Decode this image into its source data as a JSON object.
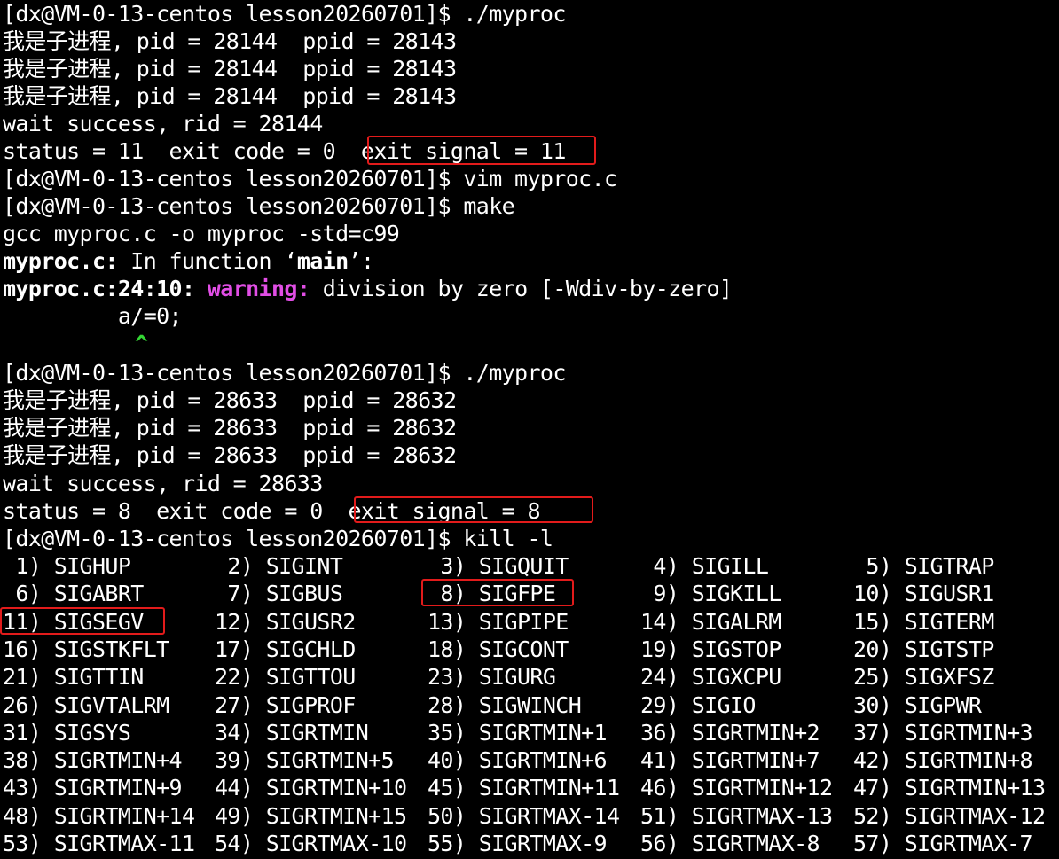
{
  "terminal": {
    "lines": [
      "[dx@VM-0-13-centos lesson20260701]$ ./myproc",
      "我是子进程, pid = 28144  ppid = 28143",
      "我是子进程, pid = 28144  ppid = 28143",
      "我是子进程, pid = 28144  ppid = 28143",
      "wait success, rid = 28144",
      "status = 11  exit code = 0  exit signal = 11",
      "[dx@VM-0-13-centos lesson20260701]$ vim myproc.c",
      "[dx@VM-0-13-centos lesson20260701]$ make",
      "gcc myproc.c -o myproc -std=c99",
      "",
      "",
      "         a/=0;",
      "",
      "",
      "[dx@VM-0-13-centos lesson20260701]$ ./myproc",
      "我是子进程, pid = 28633  ppid = 28632",
      "我是子进程, pid = 28633  ppid = 28632",
      "我是子进程, pid = 28633  ppid = 28632",
      "wait success, rid = 28633",
      "status = 8  exit code = 0  exit signal = 8",
      "[dx@VM-0-13-centos lesson20260701]$ kill -l"
    ],
    "compiler": {
      "file_prefix": "myproc.c:",
      "in_function_text": " In function ‘",
      "func_name": "main",
      "in_function_end": "’:",
      "loc_prefix": "myproc.c:24:10:",
      "warning_label": "warning:",
      "warning_text": " division by zero [-Wdiv-by-zero]",
      "caret": "^"
    },
    "signals": [
      [
        " 1) SIGHUP",
        " 2) SIGINT",
        " 3) SIGQUIT",
        " 4) SIGILL",
        " 5) SIGTRAP"
      ],
      [
        " 6) SIGABRT",
        " 7) SIGBUS",
        " 8) SIGFPE",
        " 9) SIGKILL",
        "10) SIGUSR1"
      ],
      [
        "11) SIGSEGV",
        "12) SIGUSR2",
        "13) SIGPIPE",
        "14) SIGALRM",
        "15) SIGTERM"
      ],
      [
        "16) SIGSTKFLT",
        "17) SIGCHLD",
        "18) SIGCONT",
        "19) SIGSTOP",
        "20) SIGTSTP"
      ],
      [
        "21) SIGTTIN",
        "22) SIGTTOU",
        "23) SIGURG",
        "24) SIGXCPU",
        "25) SIGXFSZ"
      ],
      [
        "26) SIGVTALRM",
        "27) SIGPROF",
        "28) SIGWINCH",
        "29) SIGIO",
        "30) SIGPWR"
      ],
      [
        "31) SIGSYS",
        "34) SIGRTMIN",
        "35) SIGRTMIN+1",
        "36) SIGRTMIN+2",
        "37) SIGRTMIN+3"
      ],
      [
        "38) SIGRTMIN+4",
        "39) SIGRTMIN+5",
        "40) SIGRTMIN+6",
        "41) SIGRTMIN+7",
        "42) SIGRTMIN+8"
      ],
      [
        "43) SIGRTMIN+9",
        "44) SIGRTMIN+10",
        "45) SIGRTMIN+11",
        "46) SIGRTMIN+12",
        "47) SIGRTMIN+13"
      ],
      [
        "48) SIGRTMIN+14",
        "49) SIGRTMIN+15",
        "50) SIGRTMAX-14",
        "51) SIGRTMAX-13",
        "52) SIGRTMAX-12"
      ],
      [
        "53) SIGRTMAX-11",
        "54) SIGRTMAX-10",
        "55) SIGRTMAX-9",
        "56) SIGRTMAX-8",
        "57) SIGRTMAX-7"
      ]
    ]
  },
  "colors": {
    "background": "#000000",
    "text": "#ffffff",
    "warning": "#e24ee6",
    "caret": "#33d633",
    "highlight_box": "#e21b1b"
  }
}
